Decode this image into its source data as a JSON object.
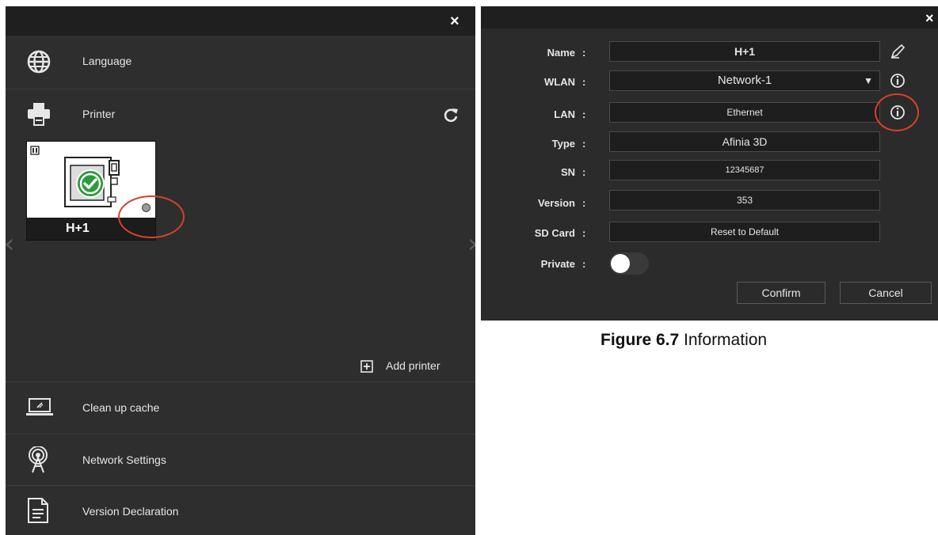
{
  "settings_panel": {
    "close_label": "×",
    "menu": {
      "language": "Language",
      "printer": "Printer",
      "clean_cache": "Clean up cache",
      "network_settings": "Network Settings",
      "version_declaration": "Version Declaration"
    },
    "printer_card": {
      "name": "H+1",
      "status": "connected"
    },
    "add_printer_label": "Add printer",
    "icons": [
      "globe-icon",
      "printer-icon",
      "refresh-icon",
      "laptop-icon",
      "antenna-icon",
      "document-icon",
      "plus-box-icon",
      "chevron-left-icon",
      "chevron-right-icon"
    ]
  },
  "info_dialog": {
    "close_label": "×",
    "fields": {
      "name": {
        "label": "Name",
        "value": "H+1"
      },
      "wlan": {
        "label": "WLAN",
        "value": "Network-1"
      },
      "lan": {
        "label": "LAN",
        "value": "Ethernet"
      },
      "type": {
        "label": "Type",
        "value": "Afinia 3D"
      },
      "sn": {
        "label": "SN",
        "value": "12345687"
      },
      "version": {
        "label": "Version",
        "value": "353"
      },
      "sd_card": {
        "label": "SD Card",
        "value": "Reset to Default"
      },
      "private": {
        "label": "Private",
        "on": false
      }
    },
    "colon": ":",
    "dropdown_arrow": "▼",
    "confirm_label": "Confirm",
    "cancel_label": "Cancel"
  },
  "caption": {
    "figure_label": "Figure 6.7",
    "text": " Information"
  },
  "colors": {
    "panel_bg": "#2e2e2e",
    "titlebar_bg": "#1f1f1f",
    "highlight_ring": "#d8402c",
    "status_check": "#2e9a3e"
  }
}
